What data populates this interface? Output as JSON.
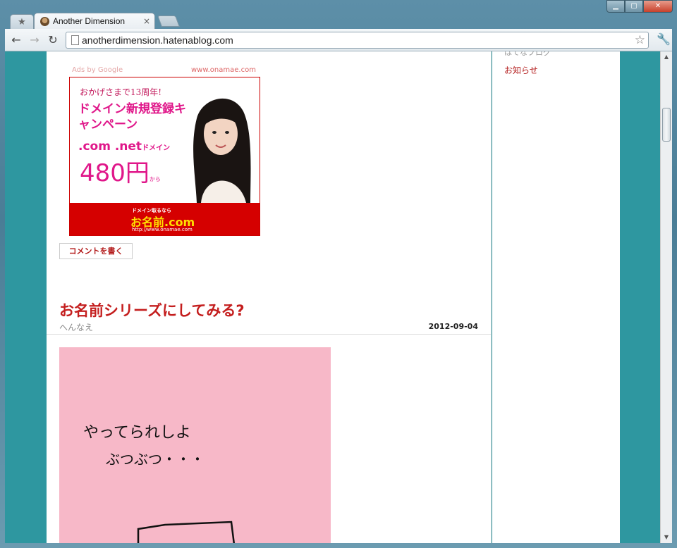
{
  "browser": {
    "tab_title": "Another Dimension",
    "url": "anotherdimension.hatenablog.com",
    "tab_close": "×"
  },
  "sidebar": {
    "cut_heading": "はてなブログ",
    "link": "お知らせ"
  },
  "ad": {
    "ads_by": "Ads by Google",
    "domain": "www.onamae.com",
    "line1": "おかげさまで13周年!",
    "line2": "ドメイン新規登録キャンペーン",
    "line3": ".com .net",
    "line3_suffix": "ドメイン",
    "price": "480円",
    "price_suffix": "から",
    "bottom_tagline": "ドメイン取るなら",
    "bottom_brand": "お名前.com",
    "bottom_url": "http://www.onamae.com"
  },
  "comment_button": "コメントを書く",
  "post": {
    "title": "お名前シリーズにしてみる?",
    "category": "へんなえ",
    "date": "2012-09-04",
    "image_text1": "やってられしよ",
    "image_text2": "ぶつぶつ・・・"
  }
}
